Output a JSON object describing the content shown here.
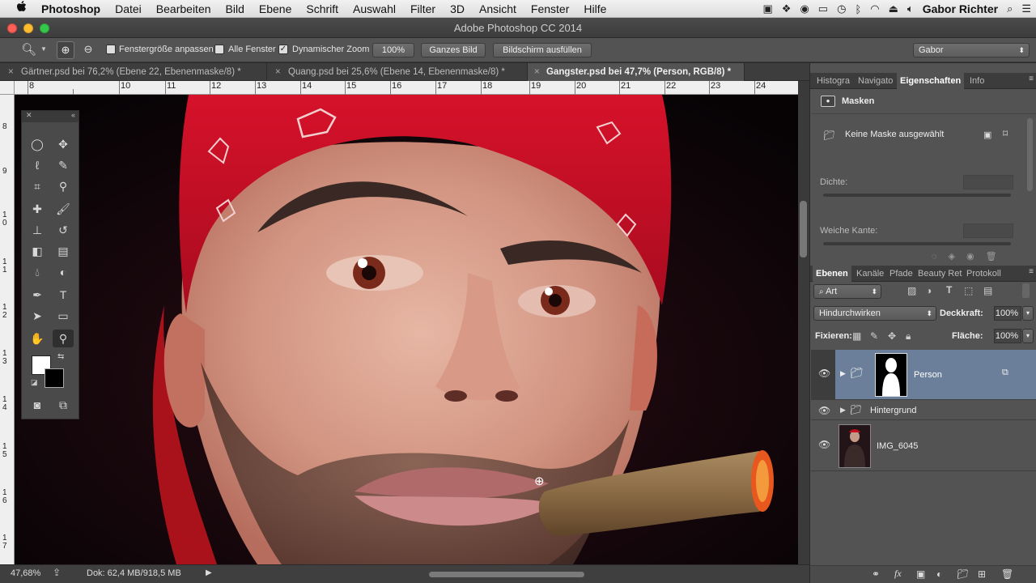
{
  "menubar": {
    "apple": "",
    "app": "Photoshop",
    "items": [
      "Datei",
      "Bearbeiten",
      "Bild",
      "Ebene",
      "Schrift",
      "Auswahl",
      "Filter",
      "3D",
      "Ansicht",
      "Fenster",
      "Hilfe"
    ],
    "user": "Gabor Richter"
  },
  "window": {
    "title": "Adobe Photoshop CC 2014"
  },
  "options": {
    "fit_window": "Fenstergröße anpassen",
    "all_windows": "Alle Fenster",
    "dynamic_zoom": "Dynamischer Zoom",
    "zoom_value": "100%",
    "fit_screen": "Ganzes Bild",
    "fill_screen": "Bildschirm ausfüllen",
    "workspace": "Gabor"
  },
  "doc_tabs": [
    {
      "label": "Gärtner.psd bei 76,2% (Ebene 22, Ebenenmaske/8) *"
    },
    {
      "label": "Quang.psd bei 25,6% (Ebene 14, Ebenenmaske/8) *"
    },
    {
      "label": "Gangster.psd bei 47,7% (Person, RGB/8) *"
    }
  ],
  "ruler": {
    "h": [
      "8",
      "10",
      "11",
      "12",
      "13",
      "14",
      "15",
      "16",
      "17",
      "18",
      "19",
      "20",
      "21",
      "22",
      "23",
      "24"
    ],
    "v": [
      "8",
      "9",
      "1\n0",
      "1\n1",
      "1\n2",
      "1\n3",
      "1\n4",
      "1\n5",
      "1\n6",
      "1\n7"
    ]
  },
  "status": {
    "zoom": "47,68%",
    "doc": "Dok: 62,4 MB/918,5 MB"
  },
  "props_panel": {
    "tabs": [
      "Histogra",
      "Navigato",
      "Eigenschaften",
      "Info"
    ],
    "section": "Masken",
    "no_mask": "Keine Maske ausgewählt",
    "density_label": "Dichte:",
    "feather_label": "Weiche Kante:"
  },
  "layers_panel": {
    "tabs": [
      "Ebenen",
      "Kanäle",
      "Pfade",
      "Beauty Ret",
      "Protokoll"
    ],
    "filter_kind": "Art",
    "blend_mode": "Hindurchwirken",
    "opacity_label": "Deckkraft:",
    "opacity_value": "100%",
    "lock_label": "Fixieren:",
    "fill_label": "Fläche:",
    "fill_value": "100%",
    "layers": [
      {
        "name": "Person"
      },
      {
        "name": "Hintergrund"
      },
      {
        "name": "IMG_6045"
      }
    ]
  }
}
